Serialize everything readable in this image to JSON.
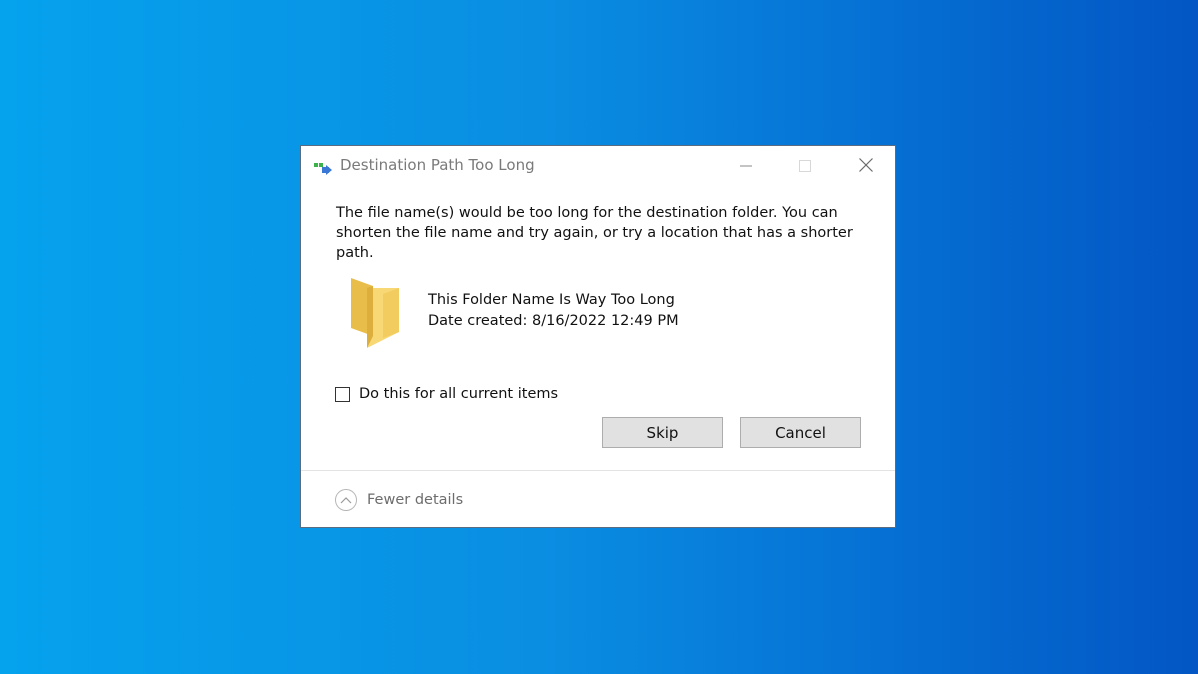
{
  "dialog": {
    "title": "Destination Path Too Long",
    "message": "The file name(s) would be too long for the destination folder. You can shorten the file name and try again, or try a location that has a shorter path.",
    "item": {
      "name": "This Folder Name Is Way Too Long",
      "date_created": "Date created: 8/16/2022 12:49 PM",
      "icon": "folder-icon"
    },
    "checkbox": {
      "label": "Do this for all current items",
      "checked": false
    },
    "buttons": {
      "skip_label": "Skip",
      "cancel_label": "Cancel"
    },
    "footer": {
      "details_label": "Fewer details",
      "icon": "chevron-up-icon"
    },
    "window_controls": [
      "minimize-icon",
      "maximize-icon",
      "close-icon"
    ]
  },
  "colors": {
    "desktop_left": "#05a2ee",
    "desktop_right": "#0356c4",
    "button_bg": "#e1e1e1",
    "folder_yellow": "#f5d46a"
  }
}
